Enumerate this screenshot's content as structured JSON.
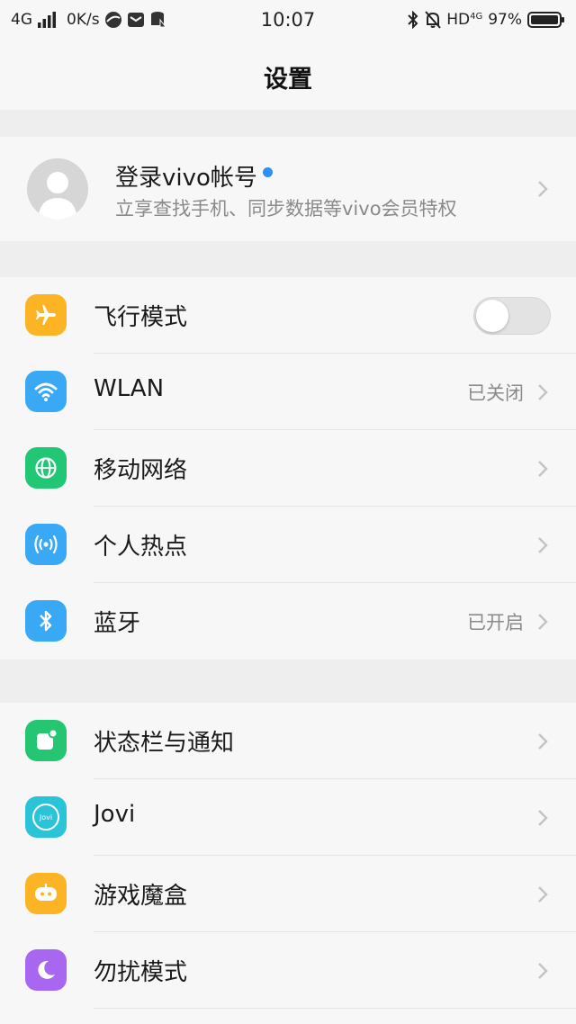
{
  "status_bar": {
    "network": "4G",
    "speed": "0K/s",
    "time": "10:07",
    "hd": "HD",
    "network_small": "4G",
    "battery": "97%"
  },
  "nav": {
    "title": "设置"
  },
  "account": {
    "title": "登录vivo帐号",
    "subtitle": "立享查找手机、同步数据等vivo会员特权"
  },
  "group1": [
    {
      "label": "飞行模式",
      "icon": "airplane-icon",
      "color": "#fcb424",
      "toggle": false
    },
    {
      "label": "WLAN",
      "icon": "wifi-icon",
      "color": "#39a9f5",
      "value": "已关闭"
    },
    {
      "label": "移动网络",
      "icon": "globe-icon",
      "color": "#22c776"
    },
    {
      "label": "个人热点",
      "icon": "hotspot-icon",
      "color": "#39a9f5"
    },
    {
      "label": "蓝牙",
      "icon": "bluetooth-icon",
      "color": "#39a9f5",
      "value": "已开启"
    }
  ],
  "group2": [
    {
      "label": "状态栏与通知",
      "icon": "notification-icon",
      "color": "#25c672"
    },
    {
      "label": "Jovi",
      "icon": "jovi-icon",
      "color": "#2bc3d8",
      "icon_text": "Jovi"
    },
    {
      "label": "游戏魔盒",
      "icon": "game-icon",
      "color": "#fcb424"
    },
    {
      "label": "勿扰模式",
      "icon": "moon-icon",
      "color": "#a867f0"
    }
  ]
}
